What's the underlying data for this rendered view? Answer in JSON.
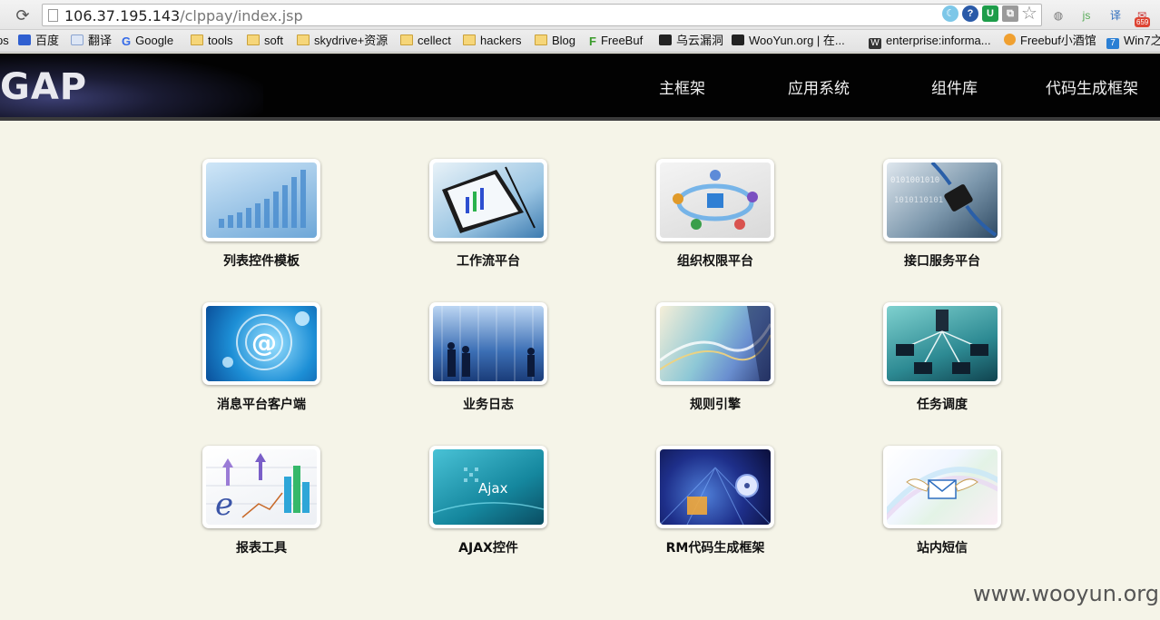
{
  "browser": {
    "url_host": "106.37.195.143",
    "url_path": "/clppay/index.jsp",
    "badge_count": "659",
    "bookmarks": [
      {
        "label": "ps",
        "icon": "partial-icon"
      },
      {
        "label": "百度",
        "icon": "baidu-icon"
      },
      {
        "label": "翻译",
        "icon": "translate-icon"
      },
      {
        "label": "Google",
        "icon": "google-icon"
      },
      {
        "label": "tools",
        "icon": "folder-icon"
      },
      {
        "label": "soft",
        "icon": "folder-icon"
      },
      {
        "label": "skydrive+资源",
        "icon": "folder-icon"
      },
      {
        "label": "cellect",
        "icon": "folder-icon"
      },
      {
        "label": "hackers",
        "icon": "folder-icon"
      },
      {
        "label": "Blog",
        "icon": "folder-icon"
      },
      {
        "label": "FreeBuf",
        "icon": "freebuf-icon"
      },
      {
        "label": "乌云漏洞",
        "icon": "wooyun-icon"
      },
      {
        "label": "WooYun.org | 在...",
        "icon": "wooyun-icon"
      },
      {
        "label": "enterprise:informa...",
        "icon": "wikipedia-icon"
      },
      {
        "label": "Freebuf小酒馆",
        "icon": "freebuf-bar-icon"
      },
      {
        "label": "Win7之",
        "icon": "win7-icon"
      }
    ]
  },
  "site": {
    "logo": "GAP",
    "nav": [
      "主框架",
      "应用系统",
      "组件库",
      "代码生成框架"
    ]
  },
  "modules": [
    {
      "label": "列表控件模板",
      "icon": "bar-chart-icon"
    },
    {
      "label": "工作流平台",
      "icon": "tablet-chart-icon"
    },
    {
      "label": "组织权限平台",
      "icon": "org-network-icon"
    },
    {
      "label": "接口服务平台",
      "icon": "cable-connector-icon"
    },
    {
      "label": "消息平台客户端",
      "icon": "email-at-icon"
    },
    {
      "label": "业务日志",
      "icon": "business-people-icon"
    },
    {
      "label": "规则引擎",
      "icon": "abstract-rules-icon"
    },
    {
      "label": "任务调度",
      "icon": "network-computers-icon"
    },
    {
      "label": "报表工具",
      "icon": "report-growth-icon"
    },
    {
      "label": "AJAX控件",
      "icon": "ajax-icon"
    },
    {
      "label": "RM代码生成框架",
      "icon": "code-disc-icon"
    },
    {
      "label": "站内短信",
      "icon": "flying-envelope-icon"
    }
  ],
  "watermark": "www.wooyun.org"
}
